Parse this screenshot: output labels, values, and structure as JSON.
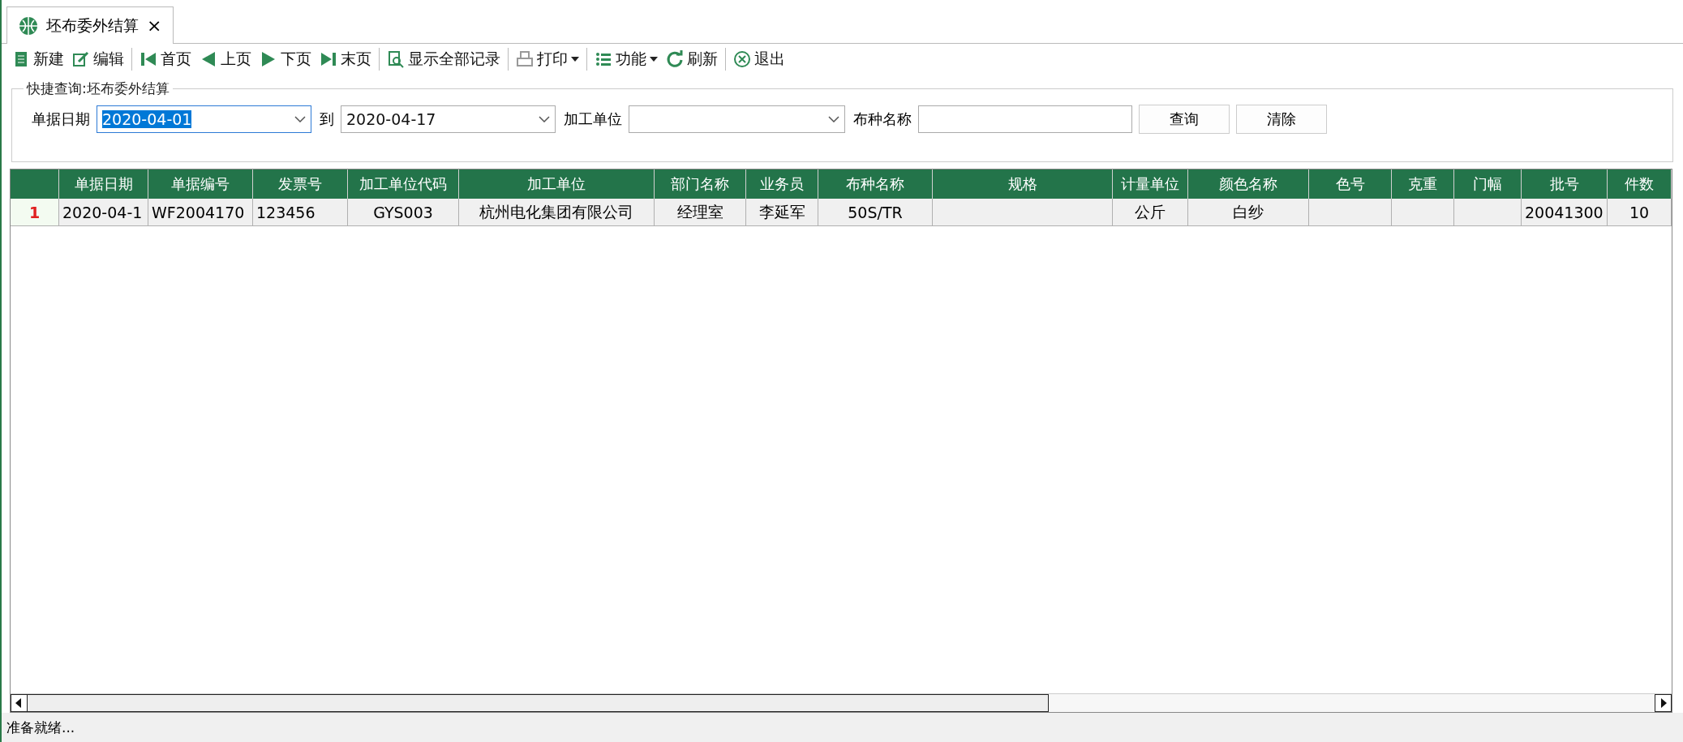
{
  "tabs": [
    {
      "label": "坯布委外结算",
      "selected": true,
      "close": "×"
    }
  ],
  "toolbar": [
    {
      "kind": "new",
      "label": "新建"
    },
    {
      "kind": "edit",
      "label": "编辑"
    },
    {
      "kind": "sep"
    },
    {
      "kind": "first",
      "label": "首页"
    },
    {
      "kind": "prev",
      "label": "上页"
    },
    {
      "kind": "next",
      "label": "下页"
    },
    {
      "kind": "last",
      "label": "末页"
    },
    {
      "kind": "sep"
    },
    {
      "kind": "showall",
      "label": "显示全部记录"
    },
    {
      "kind": "sep"
    },
    {
      "kind": "print",
      "label": "打印"
    },
    {
      "kind": "sep"
    },
    {
      "kind": "func",
      "label": "功能"
    },
    {
      "kind": "refresh",
      "label": "刷新"
    },
    {
      "kind": "sep"
    },
    {
      "kind": "exit",
      "label": "退出"
    }
  ],
  "quick_query": {
    "title": "快捷查询:坯布委外结算",
    "fields": [
      {
        "kind": "date",
        "label": "单据日期",
        "value": "2020-04-01",
        "focused": true
      },
      {
        "kind": "date",
        "label": "到",
        "value": "2020-04-17",
        "focused": false
      },
      {
        "kind": "combo",
        "label": "加工单位"
      },
      {
        "kind": "text",
        "label": "布种名称"
      }
    ],
    "buttons": [
      "查询",
      "清除"
    ]
  },
  "table": {
    "columns": [
      "单据日期",
      "单据编号",
      "发票号",
      "加工单位代码",
      "加工单位",
      "部门名称",
      "业务员",
      "布种名称",
      "规格",
      "计量单位",
      "颜色名称",
      "色号",
      "克重",
      "门幅",
      "批号",
      "件数"
    ],
    "rows": [
      {
        "number": "1",
        "selected": true,
        "cells": [
          "2020-04-1",
          "WF2004170",
          "123456",
          "GYS003",
          "杭州电化集团有限公司",
          "经理室",
          "李延军",
          "50S/TR",
          "",
          "公斤",
          "白纱",
          "",
          "",
          "",
          "20041300",
          "10"
        ]
      }
    ]
  },
  "status_bar": "准备就绪..."
}
